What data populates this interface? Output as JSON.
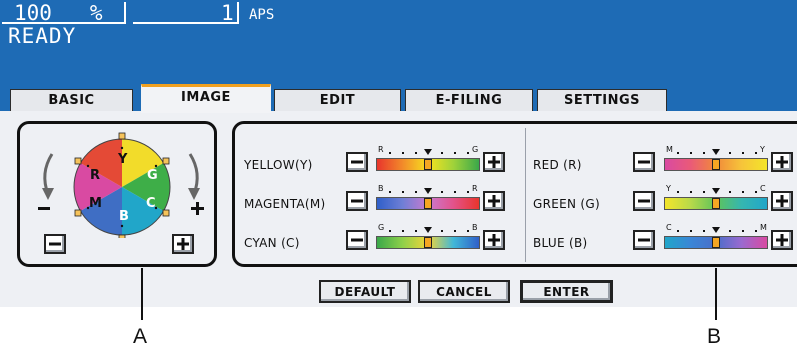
{
  "status": {
    "zoom_value": "100",
    "zoom_unit": "%",
    "copies": "1",
    "paper_mode": "APS",
    "state": "READY"
  },
  "tabs": [
    {
      "label": "BASIC",
      "active": false
    },
    {
      "label": "IMAGE",
      "active": true
    },
    {
      "label": "EDIT",
      "active": false
    },
    {
      "label": "E-FILING",
      "active": false
    },
    {
      "label": "SETTINGS",
      "active": false
    }
  ],
  "color_wheel": {
    "segments": [
      "Y",
      "G",
      "C",
      "B",
      "M",
      "R"
    ],
    "rotate_minus": "−",
    "rotate_plus": "+"
  },
  "sliders_left": [
    {
      "label": "YELLOW(Y)",
      "scale_left": "R",
      "scale_right": "G",
      "level": 0.5
    },
    {
      "label": "MAGENTA(M)",
      "scale_left": "B",
      "scale_right": "R",
      "level": 0.5
    },
    {
      "label": "CYAN (C)",
      "scale_left": "G",
      "scale_right": "B",
      "level": 0.5
    }
  ],
  "sliders_right": [
    {
      "label": "RED (R)",
      "scale_left": "M",
      "scale_right": "Y",
      "level": 0.5
    },
    {
      "label": "GREEN (G)",
      "scale_left": "Y",
      "scale_right": "C",
      "level": 0.5
    },
    {
      "label": "BLUE (B)",
      "scale_left": "C",
      "scale_right": "M",
      "level": 0.5
    }
  ],
  "actions": {
    "default_label": "DEFAULT",
    "cancel_label": "CANCEL",
    "enter_label": "ENTER"
  },
  "callouts": {
    "a": "A",
    "b": "B"
  }
}
